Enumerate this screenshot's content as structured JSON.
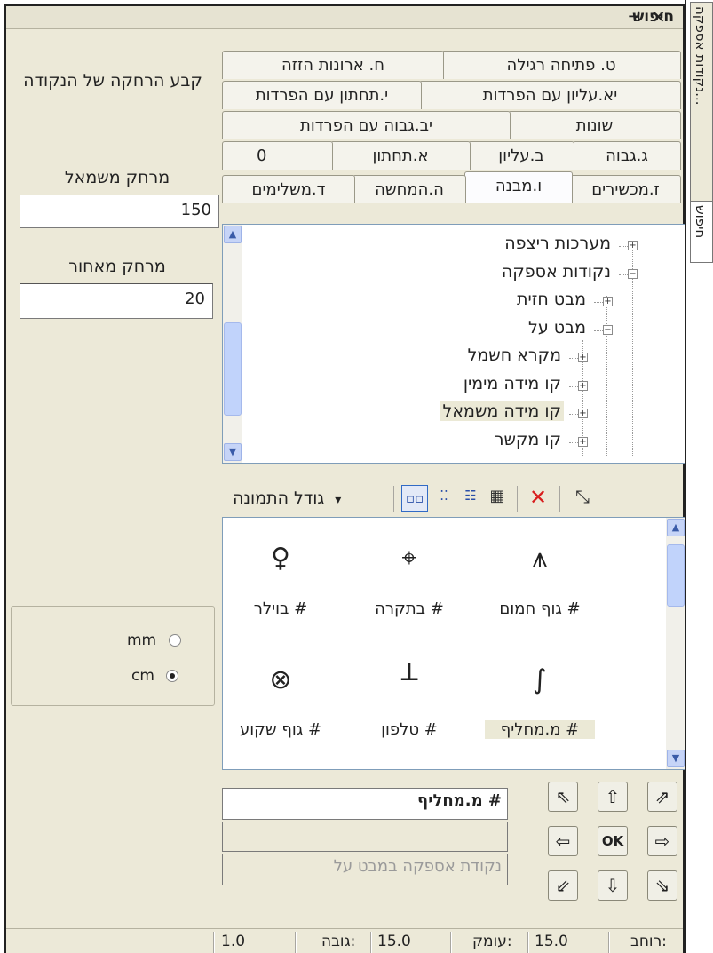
{
  "window": {
    "title": "חיפוש",
    "pin_icon": "pin-icon",
    "close_icon": "close-icon"
  },
  "side_tabs": [
    "נקודות אספקה...",
    "חיפוש"
  ],
  "settings": {
    "heading": "קבע הרחקה של הנקודה",
    "left_distance_label": "מרחק משמאל",
    "left_distance_value": "150",
    "back_distance_label": "מרחק מאחור",
    "back_distance_value": "20",
    "units": [
      {
        "label": "mm",
        "selected": false
      },
      {
        "label": "cm",
        "selected": true
      }
    ]
  },
  "tabs": {
    "row1": [
      "ט. פתיחה רגילה",
      "ח. ארונות הזזה"
    ],
    "row2": [
      "יא.עליון עם הפרדות",
      "י.תחתון עם הפרדות"
    ],
    "row3": [
      "שונות",
      "יב.גבוה עם הפרדות"
    ],
    "row4": [
      "ג.גבוה",
      "ב.עליון",
      "א.תחתון",
      "0"
    ],
    "row5": [
      "ז.מכשירים",
      "ו.מבנה",
      "ה.המחשה",
      "ד.משלימים"
    ]
  },
  "tree": {
    "items": [
      {
        "label": "מערכות ריצפה",
        "level": 0,
        "expander": "+"
      },
      {
        "label": "נקודות אספקה",
        "level": 0,
        "expander": "−"
      },
      {
        "label": "מבט חזית",
        "level": 1,
        "expander": "+"
      },
      {
        "label": "מבט על",
        "level": 1,
        "expander": "−"
      },
      {
        "label": "מקרא חשמל",
        "level": 2,
        "expander": "+"
      },
      {
        "label": "קו מידה מימין",
        "level": 2,
        "expander": "+"
      },
      {
        "label": "קו מידה משמאל",
        "level": 2,
        "expander": "+",
        "selected": true
      },
      {
        "label": "קו מקשר",
        "level": 2,
        "expander": "+"
      }
    ]
  },
  "toolbar": {
    "image_size_label": "גודל התמונה",
    "dropdown_glyph": "▾"
  },
  "symbols": [
    {
      "glyph": "⩚",
      "label": "גוף חמום #",
      "icon": "heater-symbol-icon"
    },
    {
      "glyph": "⌖",
      "label": "בתקרה #",
      "icon": "ceiling-symbol-icon"
    },
    {
      "glyph": "♀",
      "label": "בוילר #",
      "icon": "boiler-symbol-icon"
    },
    {
      "glyph": "∫",
      "label": "מ.מחליף #",
      "icon": "switch-symbol-icon",
      "selected": true
    },
    {
      "glyph": "┴",
      "label": "טלפון #",
      "icon": "phone-symbol-icon"
    },
    {
      "glyph": "⊗",
      "label": "גוף שקוע #",
      "icon": "recessed-symbol-icon"
    }
  ],
  "details": {
    "name": "מ.מחליף #",
    "empty": "",
    "description": "נקודת אספקה במבט על"
  },
  "nav": {
    "ok_label": "OK",
    "arrows": [
      "⇖",
      "⇧",
      "⇗",
      "⇦",
      "⇨",
      "⇙",
      "⇩",
      "⇘"
    ]
  },
  "status": {
    "width_label": "רוחב:",
    "width_value": "15.0",
    "depth_label": "עומק:",
    "depth_value": "15.0",
    "height_label": "גובה:",
    "height_value": "1.0"
  },
  "colors": {
    "panel": "#ece9d8",
    "selection": "#ebe9d6",
    "delete_red": "#d81e1e",
    "scroll_blue": "#c1d3fb"
  }
}
